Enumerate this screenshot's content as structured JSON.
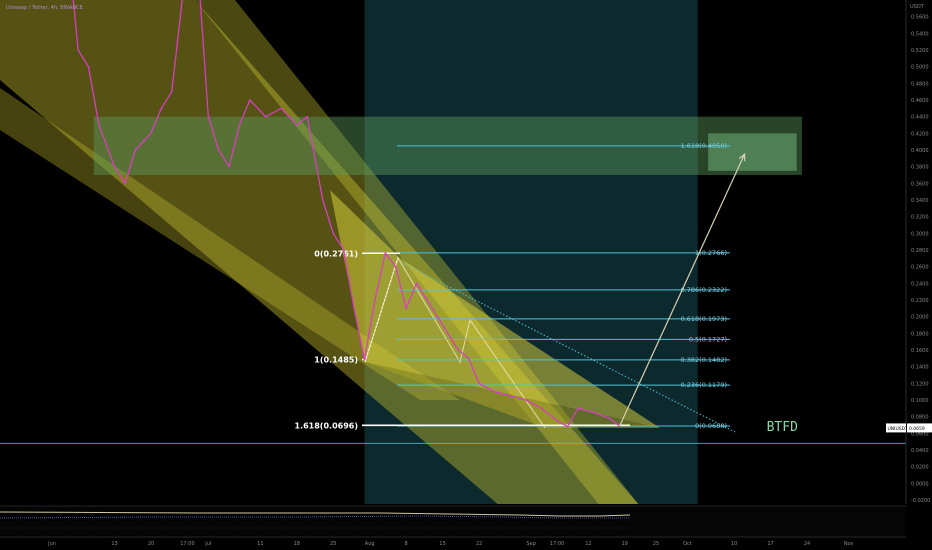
{
  "symbol_header": "Uniswap / Tether, 4h, BINANCE",
  "colors": {
    "background": "#000000",
    "price": "#d83ec0",
    "fib": "#4fc3dc",
    "channel": "#c8bf2e",
    "green_zone": "#5a9a5a",
    "price_tag": "#ffffff",
    "btfd": "#86d8a8",
    "session": "#0d3a3a"
  },
  "price_axis": {
    "unit": "USDT",
    "labels": [
      "0.5600",
      "0.5400",
      "0.5200",
      "0.5000",
      "0.4800",
      "0.4600",
      "0.4400",
      "0.4200",
      "0.4000",
      "0.3800",
      "0.3600",
      "0.3400",
      "0.3200",
      "0.3000",
      "0.2800",
      "0.2600",
      "0.2400",
      "0.2200",
      "0.2000",
      "0.1800",
      "0.1600",
      "0.1400",
      "0.1200",
      "0.1000",
      "0.0800",
      "0.0600",
      "0.0400",
      "0.0200",
      "0.0000",
      "-0.0200"
    ],
    "ylim": [
      -0.02,
      0.58
    ]
  },
  "current_price": {
    "symbol": "UNIUSDT",
    "value": "0.0659",
    "value_raw": 0.0659
  },
  "time_axis": {
    "labels": [
      {
        "label": "Jun",
        "date": "2023-06-01"
      },
      {
        "label": "13",
        "date": "2023-06-13"
      },
      {
        "label": "20",
        "date": "2023-06-20"
      },
      {
        "label": "17:00",
        "date": "2023-06-27"
      },
      {
        "label": "Jul",
        "date": "2023-07-01"
      },
      {
        "label": "11",
        "date": "2023-07-11"
      },
      {
        "label": "18",
        "date": "2023-07-18"
      },
      {
        "label": "25",
        "date": "2023-07-25"
      },
      {
        "label": "Aug",
        "date": "2023-08-01"
      },
      {
        "label": "8",
        "date": "2023-08-08"
      },
      {
        "label": "15",
        "date": "2023-08-15"
      },
      {
        "label": "22",
        "date": "2023-08-22"
      },
      {
        "label": "Sep",
        "date": "2023-09-01"
      },
      {
        "label": "17:00",
        "date": "2023-09-06"
      },
      {
        "label": "12",
        "date": "2023-09-12"
      },
      {
        "label": "19",
        "date": "2023-09-19"
      },
      {
        "label": "25",
        "date": "2023-09-25"
      },
      {
        "label": "Oct",
        "date": "2023-10-01"
      },
      {
        "label": "10",
        "date": "2023-10-10"
      },
      {
        "label": "17",
        "date": "2023-10-17"
      },
      {
        "label": "24",
        "date": "2023-10-24"
      },
      {
        "label": "Nov",
        "date": "2023-11-01"
      }
    ],
    "xlim": [
      "2023-05-22",
      "2023-11-12"
    ]
  },
  "chart_data": {
    "type": "line",
    "title": "Uniswap / Tether, 4h, BINANCE",
    "series": [
      {
        "color": "#d83ec0",
        "x": [
          "2023-06-01",
          "2023-06-04",
          "2023-06-06",
          "2023-06-08",
          "2023-06-10",
          "2023-06-13",
          "2023-06-15",
          "2023-06-17",
          "2023-06-20",
          "2023-06-22",
          "2023-06-24",
          "2023-06-26",
          "2023-06-28",
          "2023-06-29",
          "2023-07-01",
          "2023-07-03",
          "2023-07-05",
          "2023-07-07",
          "2023-07-09",
          "2023-07-12",
          "2023-07-15",
          "2023-07-18",
          "2023-07-20",
          "2023-07-23",
          "2023-07-25",
          "2023-07-27",
          "2023-07-29",
          "2023-07-31",
          "2023-08-02",
          "2023-08-04",
          "2023-08-06",
          "2023-08-08",
          "2023-08-10",
          "2023-08-12",
          "2023-08-14",
          "2023-08-16",
          "2023-08-18",
          "2023-08-20",
          "2023-08-22",
          "2023-08-25",
          "2023-08-28",
          "2023-08-31",
          "2023-09-03",
          "2023-09-06",
          "2023-09-08",
          "2023-09-10",
          "2023-09-13",
          "2023-09-16",
          "2023-09-18"
        ],
        "y": [
          0.6,
          0.65,
          0.52,
          0.5,
          0.43,
          0.38,
          0.36,
          0.4,
          0.42,
          0.45,
          0.47,
          0.58,
          0.6,
          0.62,
          0.44,
          0.4,
          0.38,
          0.43,
          0.46,
          0.44,
          0.45,
          0.43,
          0.44,
          0.34,
          0.3,
          0.28,
          0.21,
          0.1485,
          0.22,
          0.2761,
          0.26,
          0.21,
          0.24,
          0.22,
          0.2,
          0.18,
          0.16,
          0.15,
          0.12,
          0.11,
          0.105,
          0.1,
          0.09,
          0.075,
          0.068,
          0.09,
          0.085,
          0.078,
          0.0688
        ]
      }
    ],
    "fib_retracement": {
      "levels": [
        {
          "ratio": 1.618,
          "price": 0.405,
          "label": "1.618(0.4050)"
        },
        {
          "ratio": 1,
          "price": 0.2766,
          "label": "1(0.2766)"
        },
        {
          "ratio": 0.786,
          "price": 0.2322,
          "label": "0.786(0.2322)"
        },
        {
          "ratio": 0.618,
          "price": 0.1973,
          "label": "0.618(0.1973)"
        },
        {
          "ratio": 0.5,
          "price": 0.1727,
          "label": "0.5(0.1727)"
        },
        {
          "ratio": 0.382,
          "price": 0.1482,
          "label": "0.382(0.1482)"
        },
        {
          "ratio": 0.236,
          "price": 0.1179,
          "label": "0.236(0.1179)"
        },
        {
          "ratio": 0,
          "price": 0.0688,
          "label": "0(0.0688)"
        }
      ]
    },
    "fib_extension": {
      "levels": [
        {
          "ratio": 0,
          "price": 0.2761,
          "label": "0(0.2761)"
        },
        {
          "ratio": 1,
          "price": 0.1485,
          "label": "1(0.1485)"
        },
        {
          "ratio": 1.618,
          "price": 0.0696,
          "label": "1.618(0.0696)"
        }
      ]
    },
    "support_line": 0.048,
    "annotations": [
      {
        "text": "BTFD",
        "x": "2023-10-17",
        "y": 0.0688
      }
    ],
    "projection": {
      "from": {
        "x": "2023-09-18",
        "y": 0.0688
      },
      "to": {
        "x": "2023-10-12",
        "y": 0.395
      }
    },
    "green_zone": {
      "x": [
        "2023-06-09",
        "2023-10-23"
      ],
      "y": [
        0.37,
        0.44
      ]
    },
    "target_box": {
      "x": [
        "2023-10-05",
        "2023-10-22"
      ],
      "y": [
        0.375,
        0.42
      ]
    },
    "session_band": {
      "x": [
        "2023-07-31",
        "2023-10-03"
      ]
    },
    "ylim": [
      -0.02,
      0.58
    ],
    "xlim": [
      "2023-05-22",
      "2023-11-12"
    ],
    "grid": false
  }
}
